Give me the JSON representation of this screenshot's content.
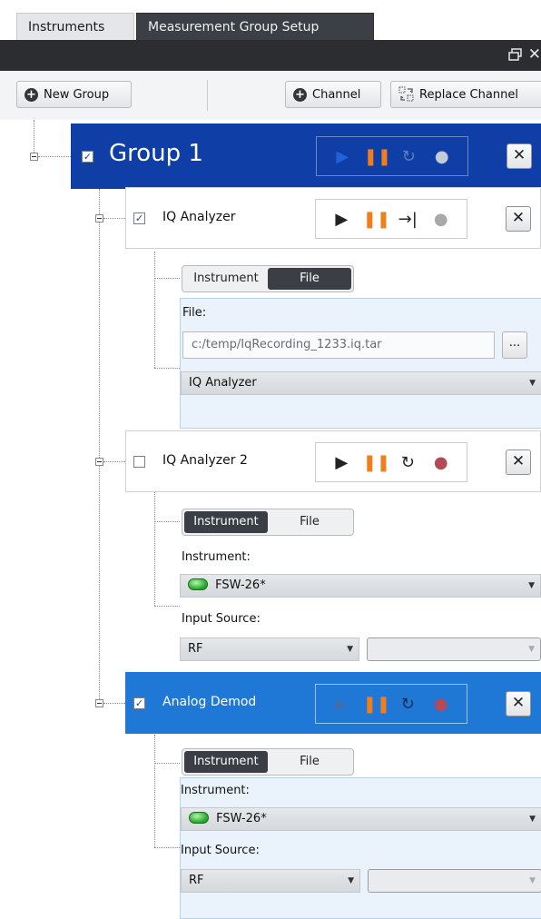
{
  "tabs": [
    {
      "label": "Instruments",
      "active": false
    },
    {
      "label": "Measurement Group Setup",
      "active": true
    }
  ],
  "toolbar": {
    "new_group": "New Group",
    "channel": "Channel",
    "replace_channel": "Replace Channel"
  },
  "group": {
    "title": "Group 1",
    "checked": true
  },
  "channels": [
    {
      "title": "IQ Analyzer",
      "checked": true,
      "mode_tabs": [
        "Instrument",
        "File"
      ],
      "active_mode": "File",
      "file_label": "File:",
      "file_path": "c:/temp/IqRecording_1233.iq.tar",
      "browse_label": "...",
      "app_select": "IQ Analyzer"
    },
    {
      "title": "IQ Analyzer 2",
      "checked": false,
      "mode_tabs": [
        "Instrument",
        "File"
      ],
      "active_mode": "Instrument",
      "instrument_label": "Instrument:",
      "instrument_value": "FSW-26*",
      "input_source_label": "Input Source:",
      "input_source_value": "RF",
      "input_source_secondary": ""
    },
    {
      "title": "Analog Demod",
      "checked": true,
      "mode_tabs": [
        "Instrument",
        "File"
      ],
      "active_mode": "Instrument",
      "instrument_label": "Instrument:",
      "instrument_value": "FSW-26*",
      "input_source_label": "Input Source:",
      "input_source_value": "RF",
      "input_source_secondary": ""
    }
  ],
  "icons": {
    "play": "play-icon",
    "pause": "pause-icon",
    "continuous": "continuous-icon",
    "single": "single-step-icon",
    "record": "record-icon",
    "close": "close-icon"
  },
  "colors": {
    "group_bar": "#0f3ea6",
    "selected_channel": "#1f78d6",
    "pause": "#f07f1b",
    "record_active": "#b34a57",
    "record_idle": "#a8a8a8"
  }
}
